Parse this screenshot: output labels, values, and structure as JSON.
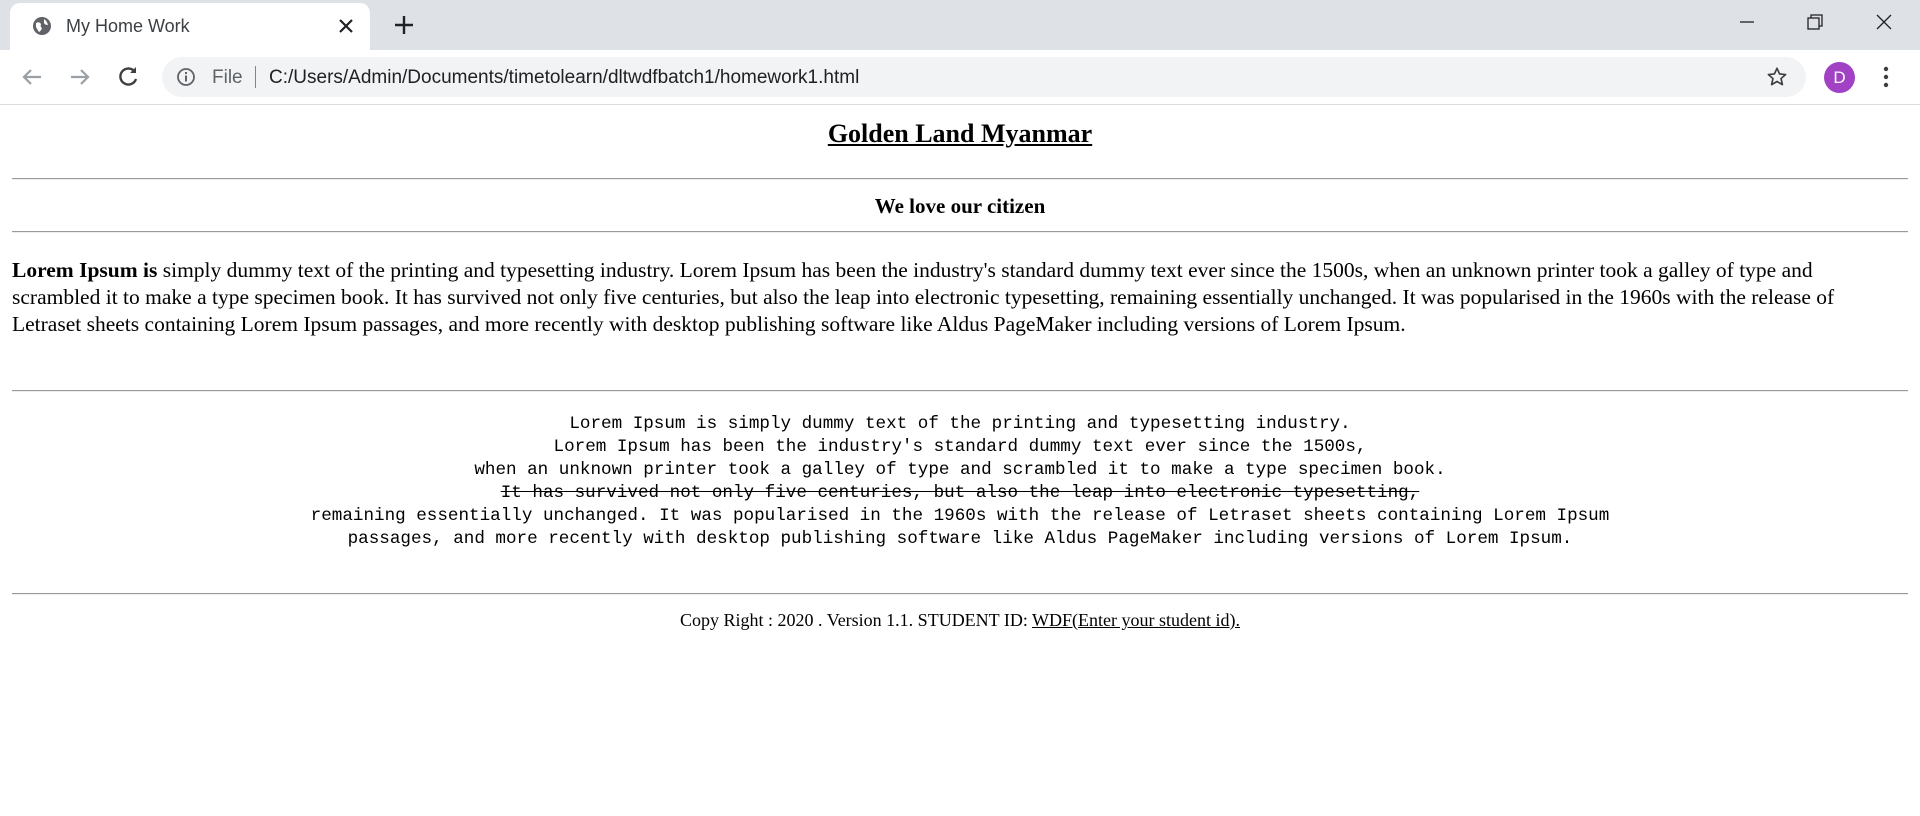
{
  "browser": {
    "tab_title": "My Home Work",
    "omnibox_scheme": "File",
    "omnibox_url": "C:/Users/Admin/Documents/timetolearn/dltwdfbatch1/homework1.html",
    "profile_initial": "D",
    "profile_color": "#a142c4",
    "icons": [
      "globe-icon",
      "close-icon",
      "plus-icon",
      "minimize-icon",
      "restore-icon",
      "window-close-icon",
      "back-arrow-icon",
      "forward-arrow-icon",
      "reload-icon",
      "info-icon",
      "star-icon",
      "kebab-menu-icon"
    ]
  },
  "page": {
    "heading": "Golden Land Myanmar",
    "subheading": "We love our citizen",
    "intro_bold": "Lorem Ipsum is",
    "intro_rest": " simply dummy text of the printing and typesetting industry. Lorem Ipsum has been the industry's standard dummy text ever since the 1500s, when an unknown printer took a galley of type and scrambled it to make a type specimen book. It has survived not only five centuries, but also the leap into electronic typesetting, remaining essentially unchanged. It was popularised in the 1960s with the release of Letraset sheets containing Lorem Ipsum passages, and more recently with desktop publishing software like Aldus PageMaker including versions of Lorem Ipsum.",
    "pre_lines": [
      "Lorem Ipsum is simply dummy text of the printing and typesetting industry.",
      "Lorem Ipsum has been the industry's standard dummy text ever since the 1500s,",
      "when an unknown printer took a galley of type and scrambled it to make a type specimen book.",
      "It has survived not only five centuries, but also the leap into electronic typesetting,",
      "remaining essentially unchanged. It was popularised in the 1960s with the release of Letraset sheets containing Lorem Ipsum",
      "passages, and more recently with desktop publishing software like Aldus PageMaker including versions of Lorem Ipsum."
    ],
    "footer_text": "Copy Right : 2020 . Version 1.1. STUDENT ID: ",
    "footer_link": "WDF(Enter your student id)."
  }
}
